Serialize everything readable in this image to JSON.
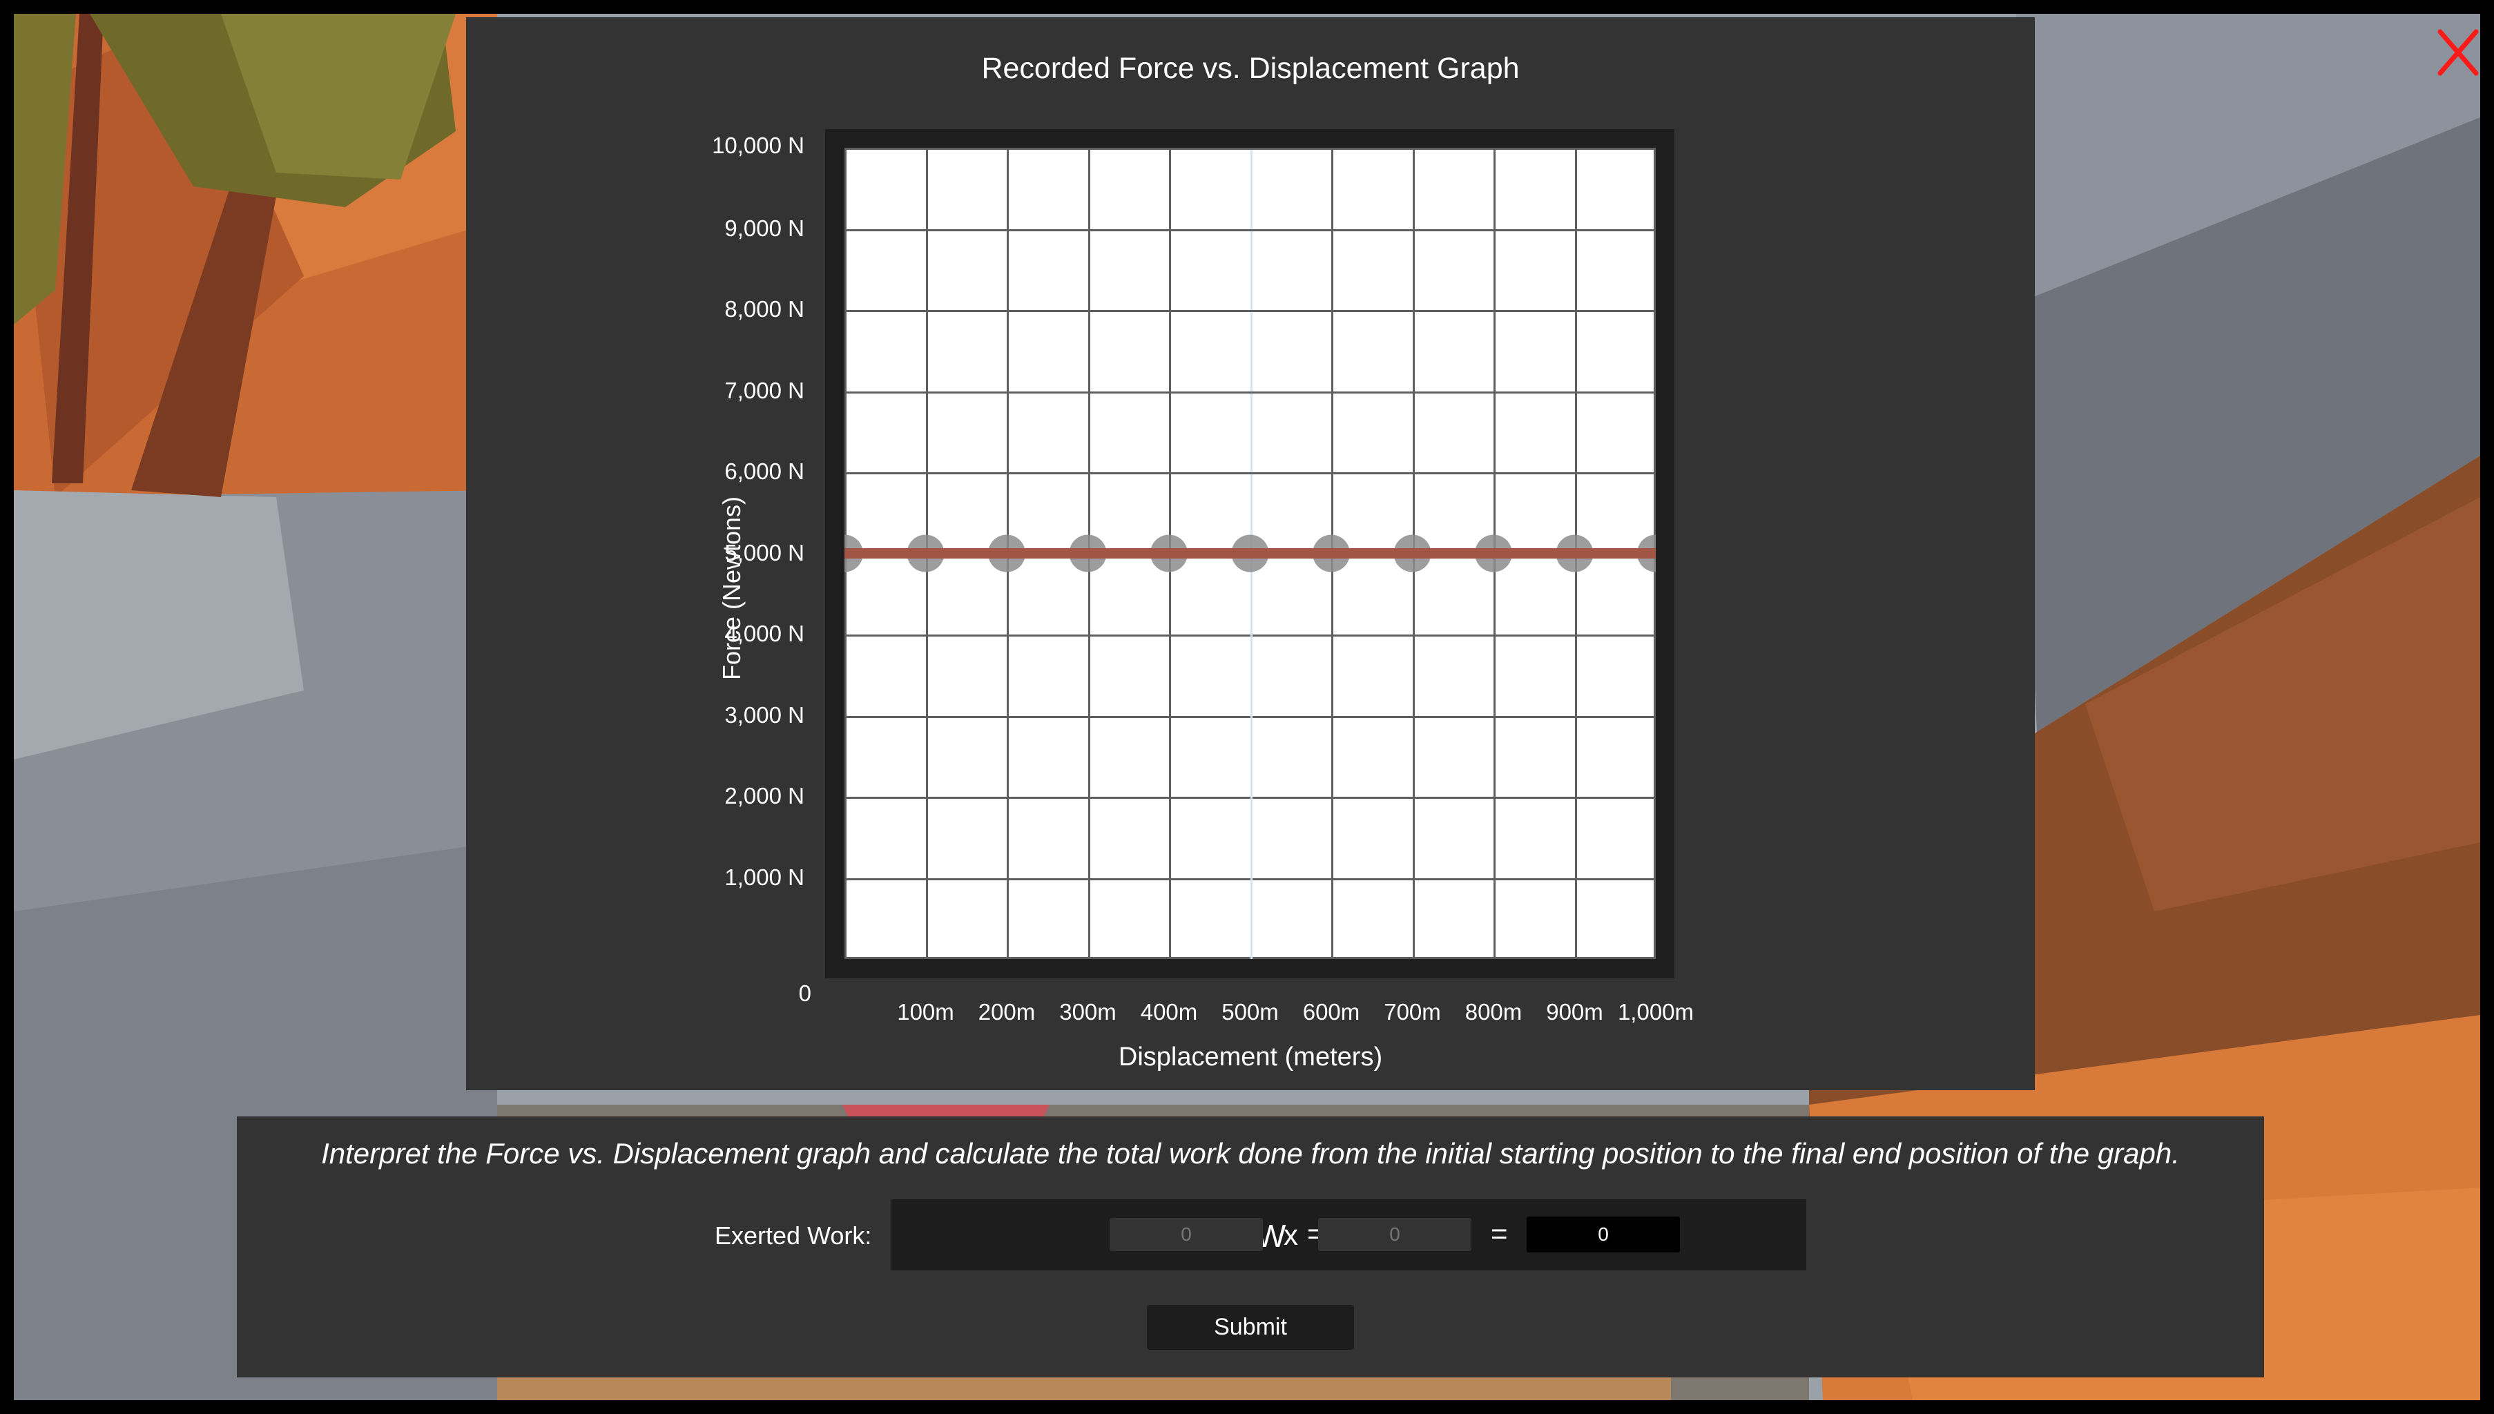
{
  "colors": {
    "panel": "#333333",
    "plot_background": "#ffffff",
    "grid": "#5f5f5f",
    "series_line": "#a05545",
    "marker": "#8c8c8c",
    "close_icon": "#ff1a1a",
    "input_field": "#333333",
    "result_field": "#000000"
  },
  "icons": {
    "close": "close-x-icon"
  },
  "graph": {
    "title": "Recorded Force vs. Displacement Graph",
    "y_axis_label": "Force (Newtons)",
    "x_axis_label": "Displacement (meters)",
    "y_ticks": [
      "0",
      "1,000 N",
      "2,000 N",
      "3,000 N",
      "4,000 N",
      "5,000 N",
      "6,000 N",
      "7,000 N",
      "8,000 N",
      "9,000 N",
      "10,000 N"
    ],
    "x_ticks": [
      "100m",
      "200m",
      "300m",
      "400m",
      "500m",
      "600m",
      "700m",
      "800m",
      "900m",
      "1,000m"
    ]
  },
  "chart_data": {
    "type": "line",
    "title": "Recorded Force vs. Displacement Graph",
    "xlabel": "Displacement (meters)",
    "ylabel": "Force (Newtons)",
    "x": [
      0,
      100,
      200,
      300,
      400,
      500,
      600,
      700,
      800,
      900,
      1000
    ],
    "series": [
      {
        "values": [
          5000,
          5000,
          5000,
          5000,
          5000,
          5000,
          5000,
          5000,
          5000,
          5000,
          5000
        ]
      }
    ],
    "xlim": [
      0,
      1000
    ],
    "ylim": [
      0,
      10000
    ],
    "grid": true
  },
  "task": {
    "instruction": "Interpret the Force vs. Displacement graph and calculate the total work done from the initial starting position to the final end position of the graph.",
    "work_label": "Exerted Work:",
    "symbol_w": "W",
    "symbol_equals": "=",
    "symbol_times": "x",
    "force_input_placeholder": "0",
    "displacement_input_placeholder": "0",
    "result_value": "0",
    "submit_label": "Submit"
  }
}
